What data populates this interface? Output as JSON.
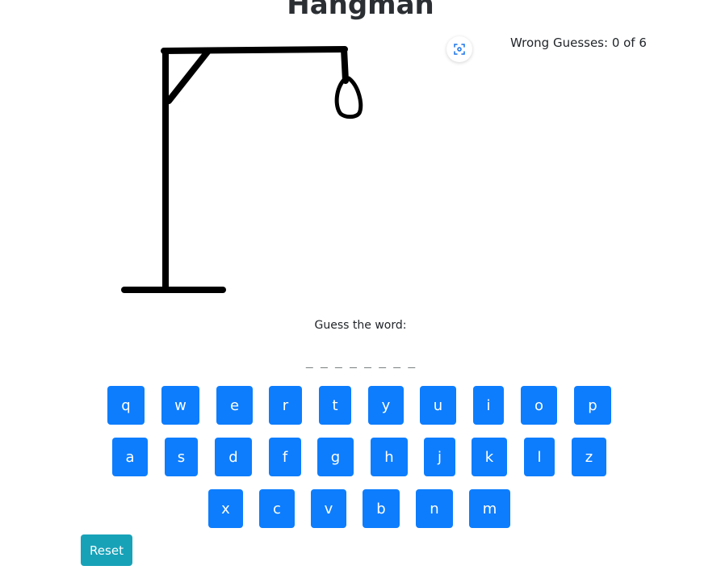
{
  "title": "Hangman",
  "wrong_guesses": "Wrong Guesses: 0 of 6",
  "prompt": "Guess the word:",
  "word_blanks": "_ _ _ _ _ _ _ _",
  "keyboard": {
    "row1": [
      "q",
      "w",
      "e",
      "r",
      "t",
      "y",
      "u",
      "i",
      "o",
      "p"
    ],
    "row2": [
      "a",
      "s",
      "d",
      "f",
      "g",
      "h",
      "j",
      "k",
      "l",
      "z"
    ],
    "row3": [
      "x",
      "c",
      "v",
      "b",
      "n",
      "m"
    ]
  },
  "reset_label": "Reset",
  "colors": {
    "key": "#0d7dfd",
    "reset": "#18a2b8"
  },
  "icons": {
    "screenshot": "screenshot-icon"
  }
}
